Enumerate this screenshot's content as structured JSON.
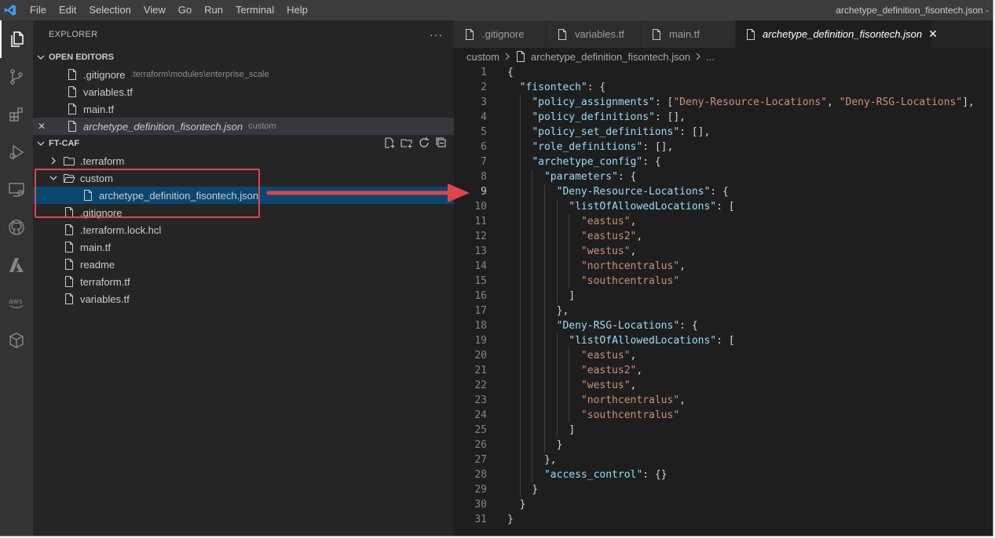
{
  "menu": [
    "File",
    "Edit",
    "Selection",
    "View",
    "Go",
    "Run",
    "Terminal",
    "Help"
  ],
  "window_title": "archetype_definition_fisontech.json - ",
  "activity_icons": [
    "explorer-icon",
    "source-control-icon",
    "extensions-icon",
    "run-debug-icon",
    "remote-explorer-icon",
    "github-icon",
    "azure-icon",
    "aws-icon",
    "package-icon"
  ],
  "sidebar": {
    "title": "EXPLORER",
    "more": "···",
    "open_editors_label": "OPEN EDITORS",
    "open_editors": [
      {
        "name": ".gitignore",
        "desc": ".terraform\\modules\\enterprise_scale",
        "italic": false,
        "close": false
      },
      {
        "name": "variables.tf",
        "desc": "",
        "italic": false,
        "close": false
      },
      {
        "name": "main.tf",
        "desc": "",
        "italic": false,
        "close": false
      },
      {
        "name": "archetype_definition_fisontech.json",
        "desc": "custom",
        "italic": true,
        "close": true
      }
    ],
    "close_symbol": "✕",
    "project_label": "FT-CAF",
    "tree": [
      {
        "name": ".terraform",
        "type": "folder-closed",
        "depth": 1
      },
      {
        "name": "custom",
        "type": "folder-open",
        "depth": 1
      },
      {
        "name": "archetype_definition_fisontech.json",
        "type": "file",
        "depth": 2,
        "active": true
      },
      {
        "name": ".gitignore",
        "type": "file",
        "depth": 1
      },
      {
        "name": ".terraform.lock.hcl",
        "type": "file",
        "depth": 1
      },
      {
        "name": "main.tf",
        "type": "file",
        "depth": 1
      },
      {
        "name": "readme",
        "type": "file",
        "depth": 1
      },
      {
        "name": "terraform.tf",
        "type": "file",
        "depth": 1
      },
      {
        "name": "variables.tf",
        "type": "file",
        "depth": 1
      }
    ]
  },
  "tabs": [
    {
      "label": ".gitignore",
      "active": false
    },
    {
      "label": "variables.tf",
      "active": false
    },
    {
      "label": "main.tf",
      "active": false
    },
    {
      "label": "archetype_definition_fisontech.json",
      "active": true
    }
  ],
  "tab_close": "✕",
  "breadcrumbs": [
    "custom",
    "archetype_definition_fisontech.json",
    "..."
  ],
  "code_lines": [
    "{",
    "  \"fisontech\": {",
    "    \"policy_assignments\": [\"Deny-Resource-Locations\", \"Deny-RSG-Locations\"],",
    "    \"policy_definitions\": [],",
    "    \"policy_set_definitions\": [],",
    "    \"role_definitions\": [],",
    "    \"archetype_config\": {",
    "      \"parameters\": {",
    "        \"Deny-Resource-Locations\": {",
    "          \"listOfAllowedLocations\": [",
    "            \"eastus\",",
    "            \"eastus2\",",
    "            \"westus\",",
    "            \"northcentralus\",",
    "            \"southcentralus\"",
    "          ]",
    "        },",
    "        \"Deny-RSG-Locations\": {",
    "          \"listOfAllowedLocations\": [",
    "            \"eastus\",",
    "            \"eastus2\",",
    "            \"westus\",",
    "            \"northcentralus\",",
    "            \"southcentralus\"",
    "          ]",
    "        }",
    "      },",
    "      \"access_control\": {}",
    "    }",
    "  }",
    "}"
  ],
  "current_line": 9,
  "colors": {
    "key": "#9cdcfe",
    "string": "#ce9178",
    "punct": "#d4d4d4",
    "highlight": "#e0454a",
    "selection": "#094771"
  }
}
